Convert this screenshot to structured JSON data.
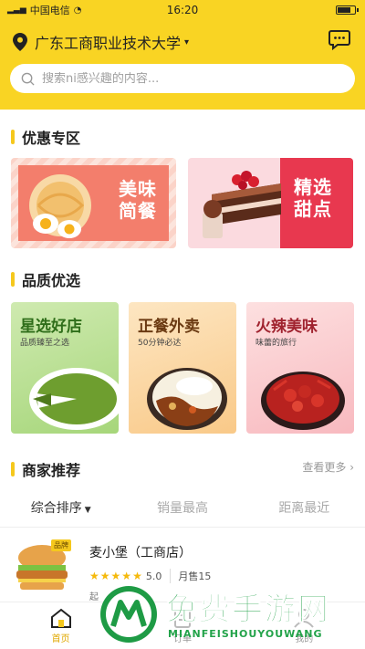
{
  "status": {
    "carrier": "中国电信",
    "time": "16:20"
  },
  "header": {
    "location": "广东工商职业技术大学",
    "search_placeholder": "搜索ni感兴趣的内容..."
  },
  "sections": {
    "discount": "优惠专区",
    "quality": "品质优选",
    "merchants": "商家推荐",
    "more": "查看更多"
  },
  "promos": [
    {
      "text": "美味简餐"
    },
    {
      "text": "精选甜点"
    }
  ],
  "quality_cards": [
    {
      "title": "星选好店",
      "subtitle": "品质臻至之选"
    },
    {
      "title": "正餐外卖",
      "subtitle": "50分钟必达"
    },
    {
      "title": "火辣美味",
      "subtitle": "味蕾的旅行"
    }
  ],
  "sort_options": [
    "综合排序",
    "销量最高",
    "距离最近"
  ],
  "shop": {
    "badge": "品牌",
    "name": "麦小堡（工商店）",
    "stars": 5,
    "score": "5.0",
    "sales": "月售15",
    "info": "起"
  },
  "tabs": [
    {
      "label": "首页",
      "icon": "home-icon"
    },
    {
      "label": "订单",
      "icon": "order-icon"
    },
    {
      "label": "我的",
      "icon": "profile-icon"
    }
  ],
  "watermark": {
    "title": "免费手游网",
    "subtitle": "MIANFEISHOUYOUWANG"
  },
  "colors": {
    "brand_yellow": "#f9d423",
    "accent_yellow": "#f5c81d",
    "promo_red": "#e8384f"
  }
}
